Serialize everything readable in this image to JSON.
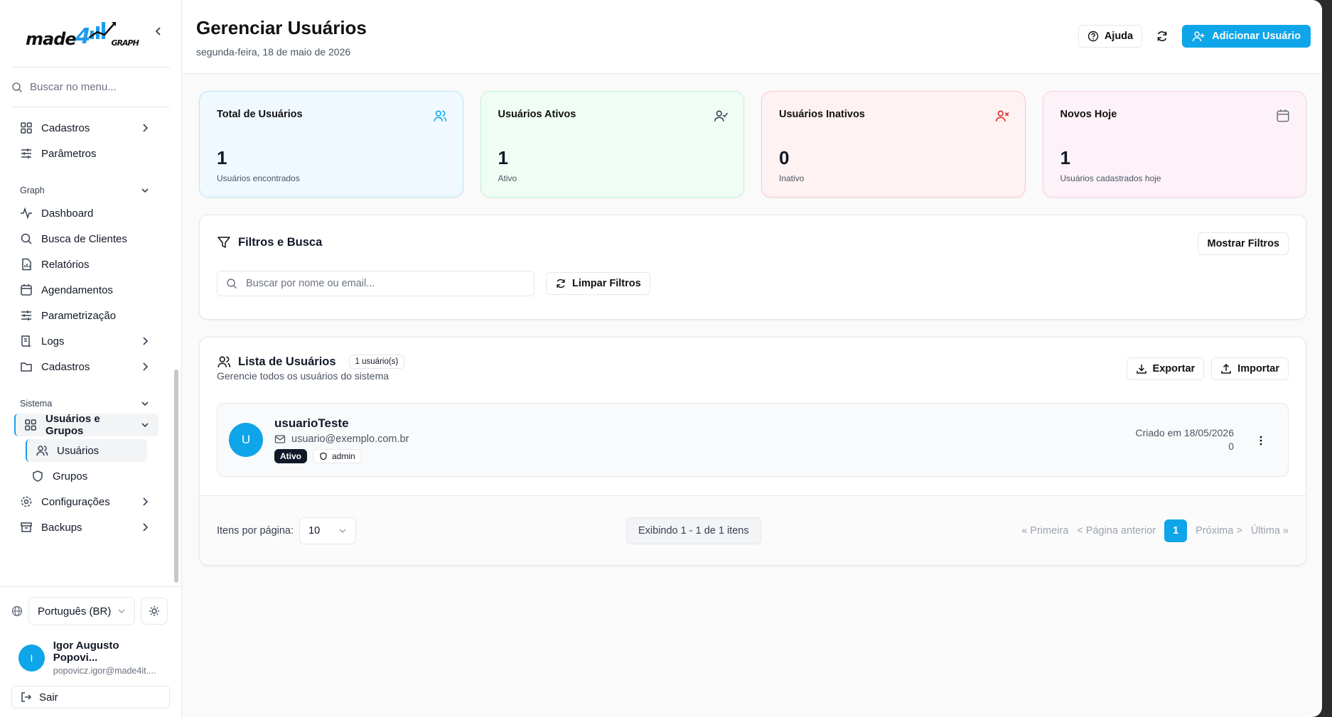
{
  "brand": {
    "logo_main": "made",
    "logo_four": "4",
    "logo_graph": "GRAPH"
  },
  "sidebar": {
    "search_placeholder": "Buscar no menu...",
    "top_items": [
      {
        "label": "Cadastros",
        "icon": "grid-icon"
      },
      {
        "label": "Parâmetros",
        "icon": "sliders-icon"
      }
    ],
    "graph_section": "Graph",
    "graph_items": [
      {
        "label": "Dashboard",
        "icon": "activity-icon"
      },
      {
        "label": "Busca de Clientes",
        "icon": "search-icon"
      },
      {
        "label": "Relatórios",
        "icon": "file-chart-icon"
      },
      {
        "label": "Agendamentos",
        "icon": "calendar-icon"
      },
      {
        "label": "Parametrização",
        "icon": "sliders-icon"
      },
      {
        "label": "Logs",
        "icon": "scroll-icon"
      },
      {
        "label": "Cadastros",
        "icon": "folder-icon"
      }
    ],
    "system_section": "Sistema",
    "system_group": "Usuários e Grupos",
    "system_sub": [
      "Usuários",
      "Grupos"
    ],
    "system_items": [
      {
        "label": "Configurações",
        "icon": "gear-icon"
      },
      {
        "label": "Backups",
        "icon": "archive-icon"
      }
    ],
    "language": "Português (BR)",
    "user_name": "Igor Augusto Popovi...",
    "user_email": "popovicz.igor@made4it....",
    "user_initial": "I",
    "logout": "Sair"
  },
  "header": {
    "title": "Gerenciar Usuários",
    "date": "segunda-feira, 18 de maio de 2026",
    "help": "Ajuda",
    "add_user": "Adicionar Usuário"
  },
  "stats": [
    {
      "title": "Total de Usuários",
      "value": "1",
      "sub": "Usuários encontrados",
      "icon": "users-icon",
      "bg": "#f0f9ff",
      "border": "#bae6fd",
      "color": "#0ea5e9"
    },
    {
      "title": "Usuários Ativos",
      "value": "1",
      "sub": "Ativo",
      "icon": "user-check-icon",
      "bg": "#f0fdf4",
      "border": "#bbf7d0",
      "color": "#374151"
    },
    {
      "title": "Usuários Inativos",
      "value": "0",
      "sub": "Inativo",
      "icon": "user-x-icon",
      "bg": "#fef2f2",
      "border": "#fecaca",
      "color": "#dc2626"
    },
    {
      "title": "Novos Hoje",
      "value": "1",
      "sub": "Usuários cadastrados hoje",
      "icon": "calendar-icon",
      "bg": "#fdf2f8",
      "border": "#fbcfe8",
      "color": "#6b7280"
    }
  ],
  "filters": {
    "title": "Filtros e Busca",
    "toggle": "Mostrar Filtros",
    "search_placeholder": "Buscar por nome ou email...",
    "clear": "Limpar Filtros"
  },
  "list": {
    "title": "Lista de Usuários",
    "count_badge": "1 usuário(s)",
    "subtitle": "Gerencie todos os usuários do sistema",
    "export": "Exportar",
    "import": "Importar",
    "users": [
      {
        "initial": "U",
        "name": "usuarioTeste",
        "email": "usuario@exemplo.com.br",
        "status": "Ativo",
        "role": "admin",
        "created": "Criado em 18/05/2026",
        "extra": "0"
      }
    ]
  },
  "pagination": {
    "per_page_label": "Itens por página:",
    "per_page": "10",
    "showing": "Exibindo 1 - 1 de 1 itens",
    "first": "« Primeira",
    "prev": "< Página anterior",
    "current": "1",
    "next": "Próxima >",
    "last": "Última »"
  }
}
